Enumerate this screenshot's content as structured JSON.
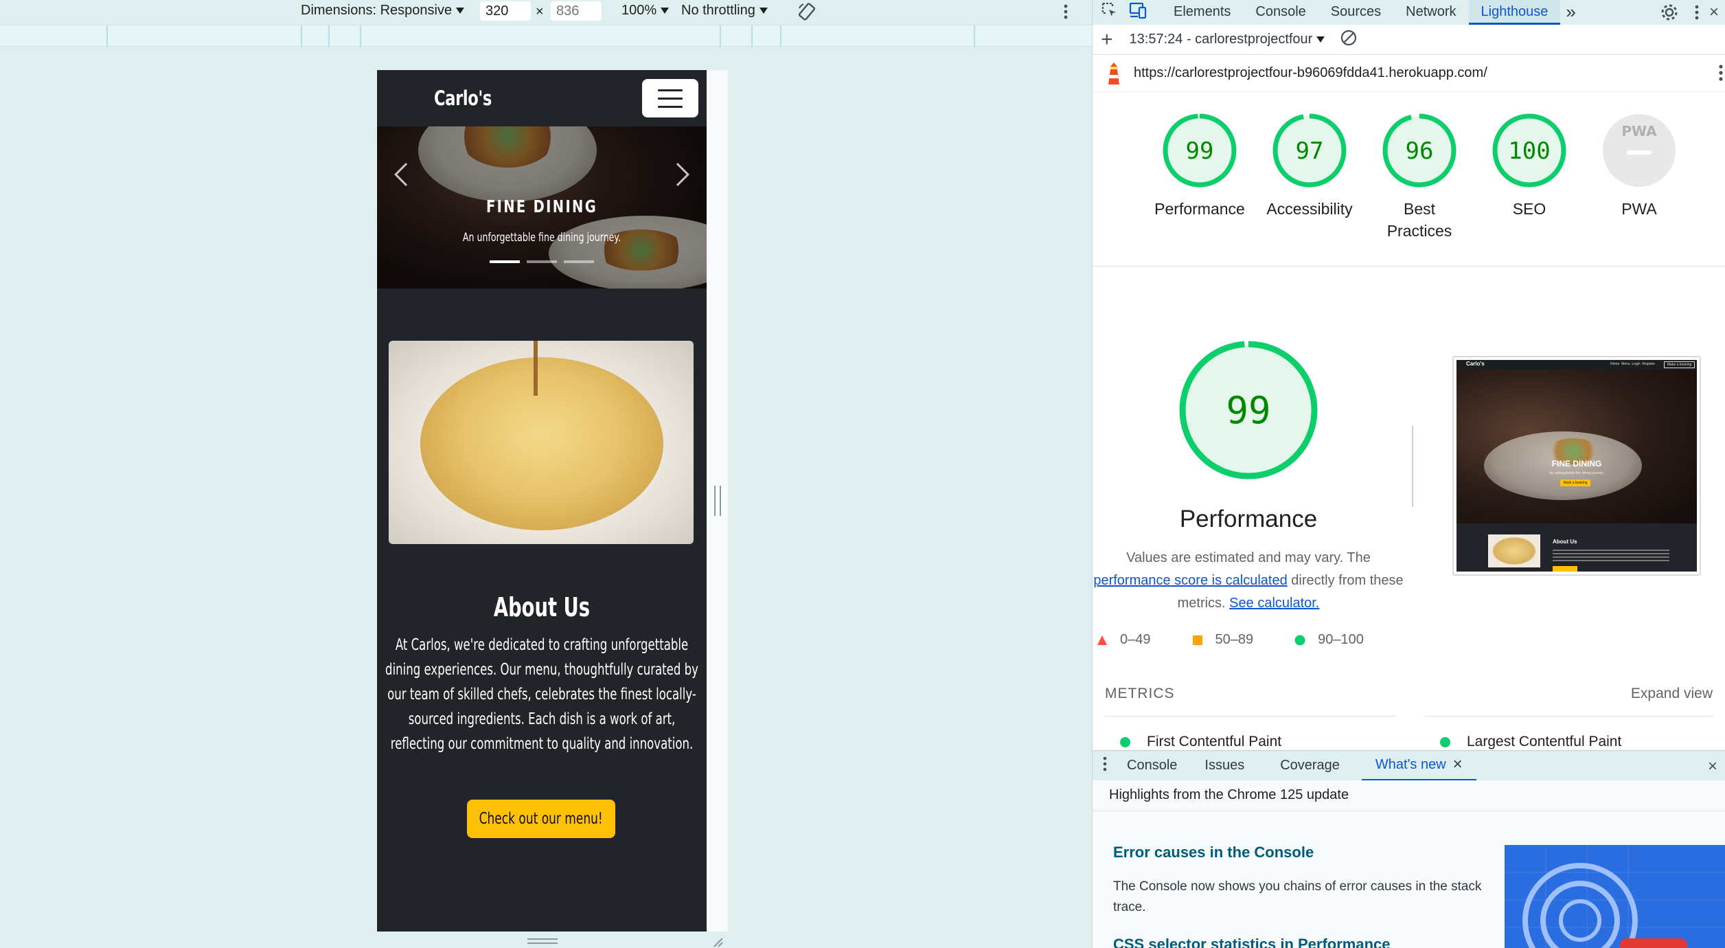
{
  "device_toolbar": {
    "dimensions_label": "Dimensions: Responsive",
    "width_value": "320",
    "times": "×",
    "height_placeholder": "836",
    "zoom": "100%",
    "throttling": "No throttling"
  },
  "site": {
    "brand": "Carlo's",
    "hero": {
      "title": "FINE DINING",
      "subtitle": "An unforgettable fine dining journey.",
      "slides": 3,
      "active_slide": 1
    },
    "about": {
      "title": "About Us",
      "text": "At Carlos, we're dedicated to crafting unforgettable dining experiences. Our menu, thoughtfully curated by our team of skilled chefs, celebrates the finest locally-sourced ingredients. Each dish is a work of art, reflecting our commitment to quality and innovation.",
      "button_label": "Check out our menu!"
    }
  },
  "devtools": {
    "tabs": [
      "Elements",
      "Console",
      "Sources",
      "Network",
      "Lighthouse"
    ],
    "active_tab": "Lighthouse",
    "more_tabs": "»",
    "report_selector": "13:57:24 - carlorestprojectfour",
    "url": "https://carlorestprojectfour-b96069fdda41.herokuapp.com/",
    "scores": [
      {
        "label": "Performance",
        "value": 99
      },
      {
        "label": "Accessibility",
        "value": 97
      },
      {
        "label": "Best Practices",
        "value": 96
      },
      {
        "label": "SEO",
        "value": 100
      },
      {
        "label": "PWA",
        "value": null,
        "badge": "PWA"
      }
    ],
    "performance": {
      "score": 99,
      "title": "Performance",
      "desc_prefix": "Values are estimated and may vary. The",
      "desc_link": "performance score is calculated",
      "desc_mid": "directly from these metrics.",
      "desc_link2": "See calculator.",
      "legend": [
        {
          "range": "0–49",
          "shape": "triangle",
          "color": "#ff4e42"
        },
        {
          "range": "50–89",
          "shape": "square",
          "color": "#ffa400"
        },
        {
          "range": "90–100",
          "shape": "circle",
          "color": "#0cce6b"
        }
      ],
      "metrics_header": "METRICS",
      "expand_label": "Expand view",
      "metrics": [
        "First Contentful Paint",
        "Largest Contentful Paint"
      ],
      "thumbnail": {
        "brand": "Carlo's",
        "nav_links": "Home  Menu  Login  Register",
        "nav_button": "Make a booking",
        "title": "FINE DINING",
        "subtitle": "An unforgettable fine dining journey.",
        "cta": "Book a booking",
        "about_title": "About Us"
      }
    },
    "colors": {
      "pass": "#0cce6b",
      "pass_dark": "#008800",
      "pass_bg": "#e5f7ec",
      "link": "#0b57d0"
    },
    "drawer": {
      "tabs": [
        "Console",
        "Issues",
        "Coverage",
        "What's new"
      ],
      "active_tab": "What's new",
      "highlights": "Highlights from the Chrome 125 update",
      "items": [
        {
          "title": "Error causes in the Console",
          "text": "The Console now shows you chains of error causes in the stack trace."
        },
        {
          "title": "CSS selector statistics in Performance",
          "text": ""
        }
      ]
    }
  }
}
